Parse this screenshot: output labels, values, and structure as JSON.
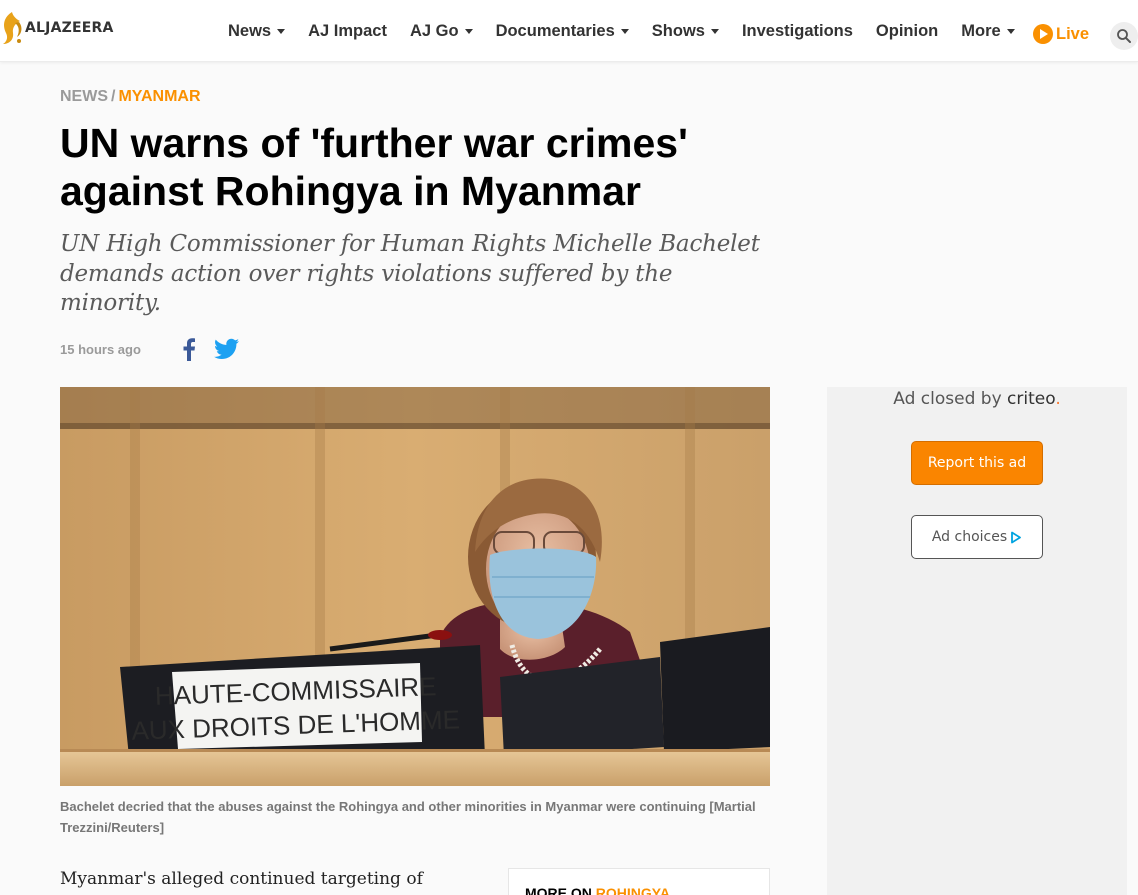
{
  "header": {
    "logo_text": "ALJAZEERA",
    "nav": [
      {
        "label": "News",
        "has_dropdown": true
      },
      {
        "label": "AJ Impact",
        "has_dropdown": false
      },
      {
        "label": "AJ Go",
        "has_dropdown": true
      },
      {
        "label": "Documentaries",
        "has_dropdown": true
      },
      {
        "label": "Shows",
        "has_dropdown": true
      },
      {
        "label": "Investigations",
        "has_dropdown": false
      },
      {
        "label": "Opinion",
        "has_dropdown": false
      },
      {
        "label": "More",
        "has_dropdown": true
      }
    ],
    "live_label": "Live",
    "search_icon": "search-icon"
  },
  "article": {
    "breadcrumb": {
      "section": "NEWS",
      "separator": "/",
      "topic": "MYANMAR"
    },
    "headline": "UN warns of 'further war crimes' against Rohingya in Myanmar",
    "subheadline": "UN High Commissioner for Human Rights Michelle Bachelet demands action over rights violations suffered by the minority.",
    "published": "15 hours ago",
    "share": [
      {
        "network": "facebook",
        "icon": "facebook-icon"
      },
      {
        "network": "twitter",
        "icon": "twitter-icon"
      }
    ],
    "image": {
      "nameplate_line1": "HAUTE-COMMISSAIRE",
      "nameplate_line2": "AUX DROITS DE L'HOMME"
    },
    "caption": "Bachelet decried that the abuses against the Rohingya and other minorities in Myanmar were continuing [Martial Trezzini/Reuters]",
    "body_first_line": "Myanmar's alleged continued targeting of civilians",
    "more_on": {
      "prefix": "MORE ON",
      "topic": "ROHINGYA"
    }
  },
  "ad": {
    "closed_by": "Ad closed by",
    "provider": "criteo",
    "report_label": "Report this ad",
    "choices_label": "Ad choices"
  },
  "colors": {
    "accent": "#fa9000",
    "muted_text": "#9a9a9a",
    "facebook": "#3b5998",
    "twitter": "#1da1f2"
  }
}
